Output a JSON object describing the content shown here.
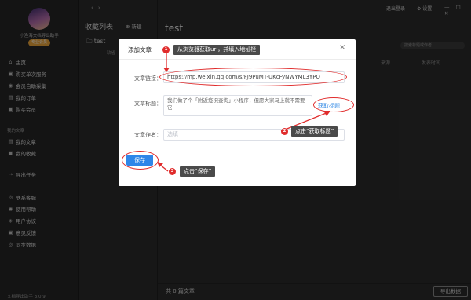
{
  "sidebar": {
    "app_title": "小渔海文档导出助手",
    "badge": "专业会员",
    "main_items": [
      {
        "label": "主页",
        "icon": "home-icon",
        "glyph": "⌂"
      },
      {
        "label": "购买单次服务",
        "icon": "cart-icon",
        "glyph": "▣"
      },
      {
        "label": "会员自助采集",
        "icon": "people-icon",
        "glyph": "◉"
      },
      {
        "label": "我的订单",
        "icon": "order-icon",
        "glyph": "▤"
      },
      {
        "label": "购买会员",
        "icon": "crown-icon",
        "glyph": "▣"
      }
    ],
    "section_my_articles": "我的文章",
    "article_items": [
      {
        "label": "我的文章",
        "icon": "document-icon",
        "glyph": "▤"
      },
      {
        "label": "我的收藏",
        "icon": "favorite-icon",
        "glyph": "▣"
      }
    ],
    "export_item": {
      "label": "导出任务",
      "icon": "export-icon",
      "glyph": "↦"
    },
    "bottom_items": [
      {
        "label": "联系客服",
        "icon": "service-icon",
        "glyph": "◎"
      },
      {
        "label": "使用帮助",
        "icon": "help-icon",
        "glyph": "◉"
      },
      {
        "label": "用户协议",
        "icon": "agreement-icon",
        "glyph": "◈"
      },
      {
        "label": "意见反馈",
        "icon": "feedback-icon",
        "glyph": "▣"
      },
      {
        "label": "同步数据",
        "icon": "sync-icon",
        "glyph": "◎"
      }
    ],
    "version": "文档导出助手 3.0.9"
  },
  "list_pane": {
    "title": "收藏列表",
    "new_label": "新建",
    "folder": "test",
    "sub_label": "缺省"
  },
  "toolbar": {
    "back": "‹",
    "forward": "›",
    "logout": "退出登录",
    "settings": "设置",
    "window_controls": "— □ ✕"
  },
  "main": {
    "title": "test",
    "search_placeholder": "搜索标题或作者",
    "columns": [
      "来源",
      "发表时间"
    ],
    "count_text": "共 0 篇文章",
    "export_button": "导出数据"
  },
  "modal": {
    "title": "添加文章",
    "close": "×",
    "url_label": "文章链接：",
    "url_value": "https://mp.weixin.qq.com/s/FJ9PuMT-UKcFyNWYML3YPQ",
    "title_label": "文章标题：",
    "title_value": "我们做了个「附近疫况查询」小程序，但愿大家马上就不需要它",
    "fetch_title": "获取标题",
    "author_label": "文章作者：",
    "author_placeholder": "选填",
    "save_label": "保存"
  },
  "annotations": [
    {
      "num": "1",
      "text": "从浏览器获取url，并填入地址栏"
    },
    {
      "num": "2",
      "text": "点击“获取标题”"
    },
    {
      "num": "3",
      "text": "点击“保存”"
    }
  ],
  "colors": {
    "accent": "#2f86e8",
    "annotation": "#e02c2c",
    "badge": "#e8a23a"
  }
}
